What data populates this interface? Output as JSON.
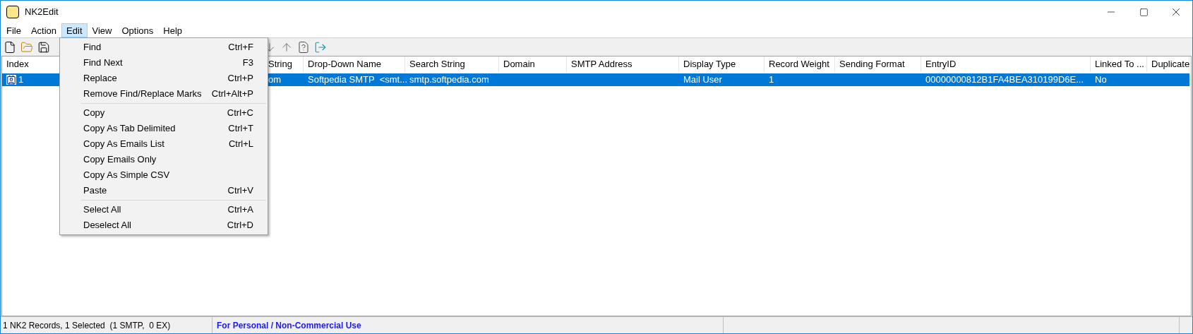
{
  "window": {
    "title": "NK2Edit"
  },
  "menu_bar": [
    {
      "label": "File",
      "selected": false
    },
    {
      "label": "Action",
      "selected": false
    },
    {
      "label": "Edit",
      "selected": true
    },
    {
      "label": "View",
      "selected": false
    },
    {
      "label": "Options",
      "selected": false
    },
    {
      "label": "Help",
      "selected": false
    }
  ],
  "edit_menu": [
    {
      "kind": "item",
      "label": "Find",
      "shortcut": "Ctrl+F"
    },
    {
      "kind": "item",
      "label": "Find Next",
      "shortcut": "F3"
    },
    {
      "kind": "item",
      "label": "Replace",
      "shortcut": "Ctrl+P"
    },
    {
      "kind": "item",
      "label": "Remove Find/Replace Marks",
      "shortcut": "Ctrl+Alt+P"
    },
    {
      "kind": "separator"
    },
    {
      "kind": "item",
      "label": "Copy",
      "shortcut": "Ctrl+C"
    },
    {
      "kind": "item",
      "label": "Copy As Tab Delimited",
      "shortcut": "Ctrl+T"
    },
    {
      "kind": "item",
      "label": "Copy As Emails List",
      "shortcut": "Ctrl+L"
    },
    {
      "kind": "item",
      "label": "Copy Emails Only"
    },
    {
      "kind": "item",
      "label": "Copy As Simple CSV"
    },
    {
      "kind": "item",
      "label": "Paste",
      "shortcut": "Ctrl+V"
    },
    {
      "kind": "separator"
    },
    {
      "kind": "item",
      "label": "Select All",
      "shortcut": "Ctrl+A"
    },
    {
      "kind": "item",
      "label": "Deselect All",
      "shortcut": "Ctrl+D"
    }
  ],
  "table": {
    "columns": [
      "Index",
      "",
      "String",
      "Drop-Down Name",
      "Search String",
      "Domain",
      "SMTP Address",
      "Display Type",
      "Record Weight",
      "Sending Format",
      "EntryID",
      "Linked To ...",
      "Duplicate"
    ],
    "rows": [
      {
        "selected": true,
        "cells": [
          "1",
          "",
          "om",
          "Softpedia SMTP  <smt...",
          "smtp.softpedia.com",
          "",
          "",
          "Mail User",
          "1",
          "",
          "00000000812B1FA4BEA310199D6E...",
          "No",
          ""
        ]
      }
    ]
  },
  "status_bar": [
    "1 NK2 Records, 1 Selected  (1 SMTP,  0 EX)",
    "For Personal / Non-Commercial Use"
  ]
}
